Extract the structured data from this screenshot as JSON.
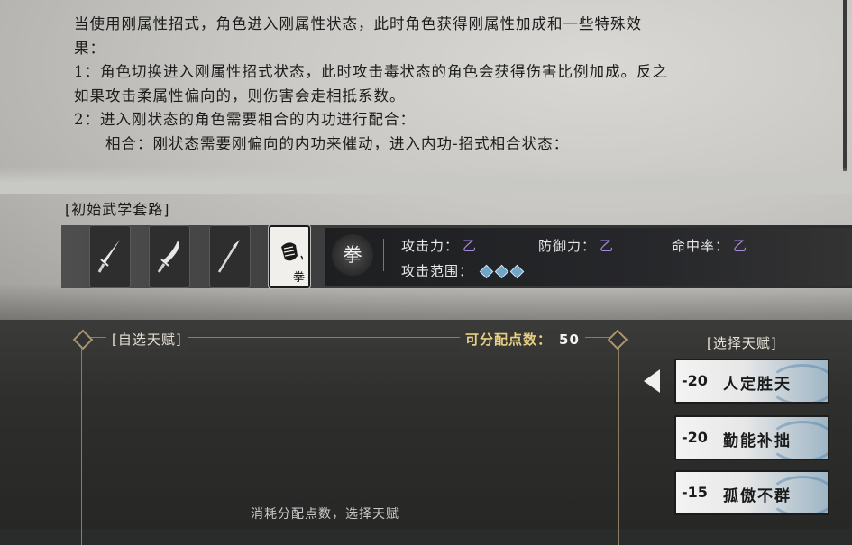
{
  "description": {
    "lines": [
      "当使用刚属性招式，角色进入刚属性状态，此时角色获得刚属性加成和一些特殊效",
      "果：",
      "1：角色切换进入刚属性招式状态，此时攻击毒状态的角色会获得伤害比例加成。反之",
      "如果攻击柔属性偏向的，则伤害会走相抵系数。",
      "2：进入刚状态的角色需要相合的内功进行配合：",
      "相合：刚状态需要刚偏向的内功来催动，进入内功-招式相合状态："
    ]
  },
  "loadout": {
    "title": "[初始武学套路]",
    "slots": [
      {
        "icon": "sword-icon"
      },
      {
        "icon": "saber-icon"
      },
      {
        "icon": "spear-icon"
      },
      {
        "icon": "fist-icon",
        "label": "拳"
      }
    ]
  },
  "stats": {
    "weapon_type": "拳",
    "attack_label": "攻击力：",
    "attack_value": "乙",
    "defense_label": "防御力：",
    "defense_value": "乙",
    "hit_label": "命中率：",
    "hit_value": "乙",
    "range_label": "攻击范围："
  },
  "talents_panel": {
    "title": "[自选天赋]",
    "points_label": "可分配点数：",
    "points_value": "50",
    "hint": "消耗分配点数，选择天赋"
  },
  "talent_select": {
    "title": "[选择天赋]",
    "items": [
      {
        "cost": "-20",
        "name": "人定胜天"
      },
      {
        "cost": "-20",
        "name": "勤能补拙"
      },
      {
        "cost": "-15",
        "name": "孤傲不群"
      }
    ]
  },
  "colors": {
    "grade": "#a98be0",
    "points_label": "#e6cf84",
    "range_gem": "#6fa5c7"
  }
}
